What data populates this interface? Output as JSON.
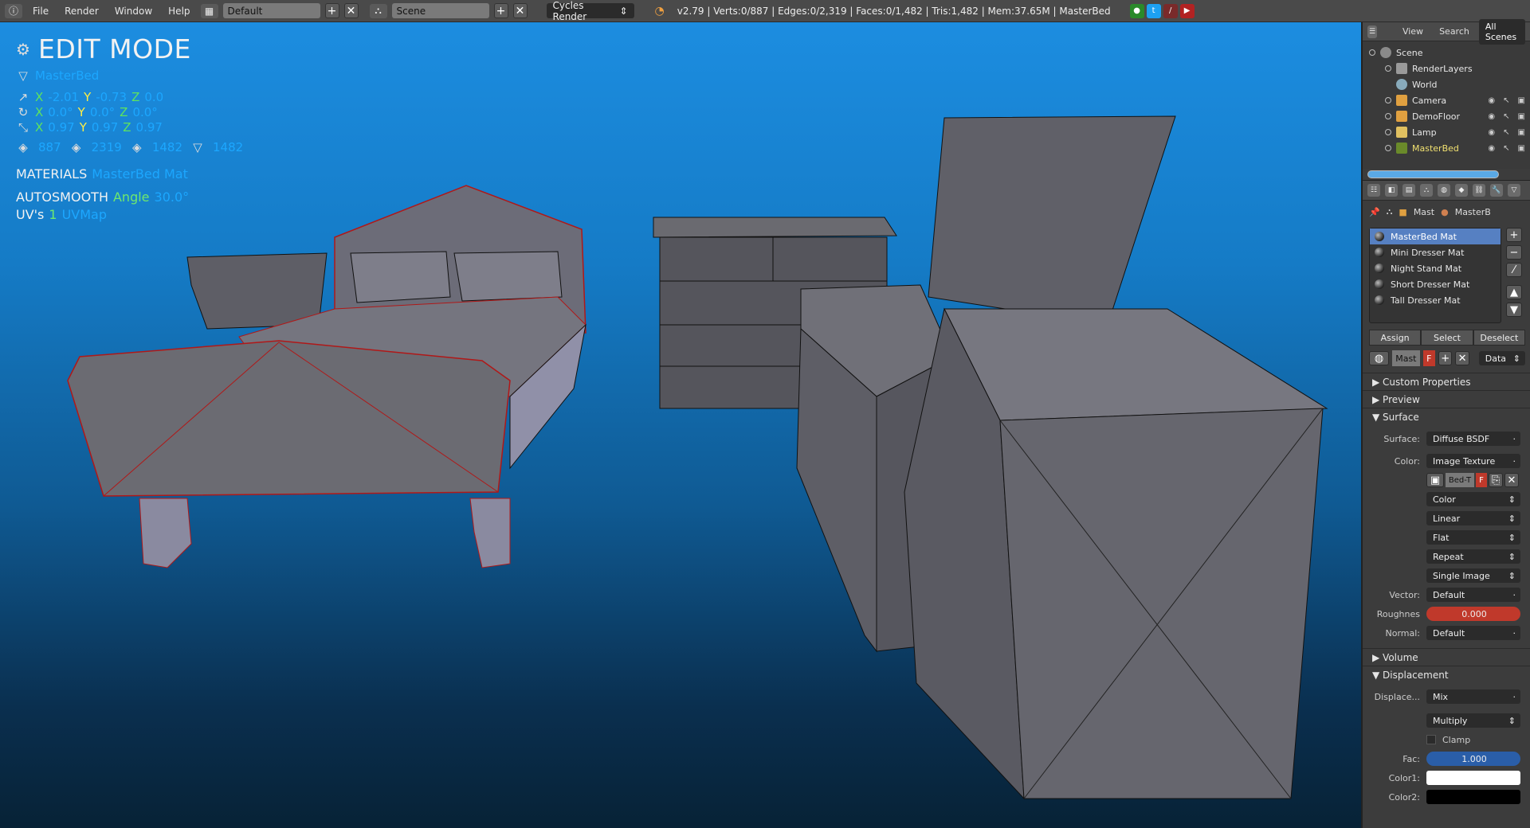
{
  "topbar": {
    "menus": [
      "File",
      "Render",
      "Window",
      "Help"
    ],
    "layout": "Default",
    "scene": "Scene",
    "engine": "Cycles Render",
    "stats": "v2.79 | Verts:0/887 | Edges:0/2,319 | Faces:0/1,482 | Tris:1,482 | Mem:37.65M | MasterBed"
  },
  "overlay": {
    "mode": "EDIT MODE",
    "object_name": "MasterBed",
    "loc": {
      "x_label": "X",
      "x": "-2.01",
      "y_label": "Y",
      "y": "-0.73",
      "z_label": "Z",
      "z": "0.0"
    },
    "rot": {
      "x_label": "X",
      "x": "0.0°",
      "y_label": "Y",
      "y": "0.0°",
      "z_label": "Z",
      "z": "0.0°"
    },
    "scale": {
      "x_label": "X",
      "x": "0.97",
      "y_label": "Y",
      "y": "0.97",
      "z_label": "Z",
      "z": "0.97"
    },
    "counts": {
      "verts": "887",
      "edges": "2319",
      "faces": "1482",
      "tris": "1482"
    },
    "materials_label": "MATERIALS",
    "materials_value": "MasterBed Mat",
    "autosmooth_label": "AUTOSMOOTH",
    "angle_label": "Angle",
    "angle_value": "30.0°",
    "uvs_label": "UV's",
    "uvs_count": "1",
    "uvs_name": "UVMap"
  },
  "outliner": {
    "tabs": [
      "View",
      "Search",
      "All Scenes"
    ],
    "items": [
      {
        "label": "Scene"
      },
      {
        "label": "RenderLayers"
      },
      {
        "label": "World"
      },
      {
        "label": "Camera"
      },
      {
        "label": "DemoFloor"
      },
      {
        "label": "Lamp"
      },
      {
        "label": "MasterBed"
      }
    ]
  },
  "properties": {
    "crumb_obj": "Mast",
    "crumb_mat": "MasterB",
    "materials": [
      "MasterBed Mat",
      "Mini Dresser Mat",
      "Night Stand Mat",
      "Short Dresser Mat",
      "Tall Dresser Mat"
    ],
    "assign": "Assign",
    "select": "Select",
    "deselect": "Deselect",
    "mat_short": "Mast",
    "fake_user": "F",
    "data_link": "Data",
    "sections": {
      "custom": "Custom Properties",
      "preview": "Preview",
      "surface": "Surface",
      "volume": "Volume",
      "displacement": "Displacement"
    },
    "surface": {
      "surface_label": "Surface:",
      "surface_value": "Diffuse BSDF",
      "color_label": "Color:",
      "color_value": "Image Texture",
      "image": "Bed-T",
      "opts": [
        "Color",
        "Linear",
        "Flat",
        "Repeat",
        "Single Image"
      ],
      "vector_label": "Vector:",
      "vector_value": "Default",
      "rough_label": "Roughnes",
      "rough_value": "0.000",
      "normal_label": "Normal:",
      "normal_value": "Default"
    },
    "displacement": {
      "label": "Displace...",
      "value": "Mix",
      "blend": "Multiply",
      "clamp": "Clamp",
      "fac_label": "Fac:",
      "fac_value": "1.000",
      "c1_label": "Color1:",
      "c2_label": "Color2:"
    }
  }
}
